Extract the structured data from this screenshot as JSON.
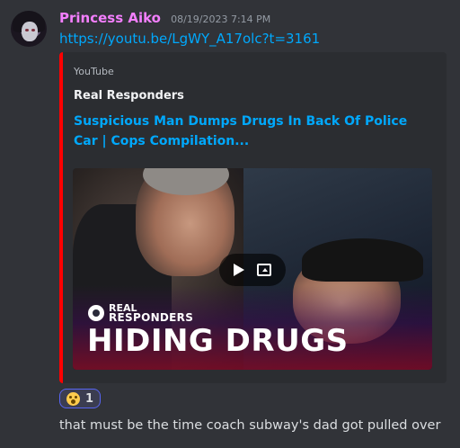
{
  "message": {
    "username": "Princess Aiko",
    "timestamp": "08/19/2023 7:14 PM",
    "link_text": "https://youtu.be/LgWY_A17olc?t=3161",
    "text": "that must be the time coach subway's dad got pulled over"
  },
  "embed": {
    "provider": "YouTube",
    "author": "Real Responders",
    "title": "Suspicious Man Dumps Drugs In Back Of Police Car | Cops Compilation...",
    "accent_color": "#ff0000",
    "thumbnail": {
      "brand_line1": "REAL",
      "brand_line2": "RESPONDERS",
      "headline": "HIDING DRUGS"
    }
  },
  "reaction": {
    "emoji": "astonished-face",
    "count": "1"
  },
  "colors": {
    "username": "#f47fff",
    "link": "#00a8fc",
    "background": "#313338",
    "embed_bg": "#2b2d31"
  }
}
